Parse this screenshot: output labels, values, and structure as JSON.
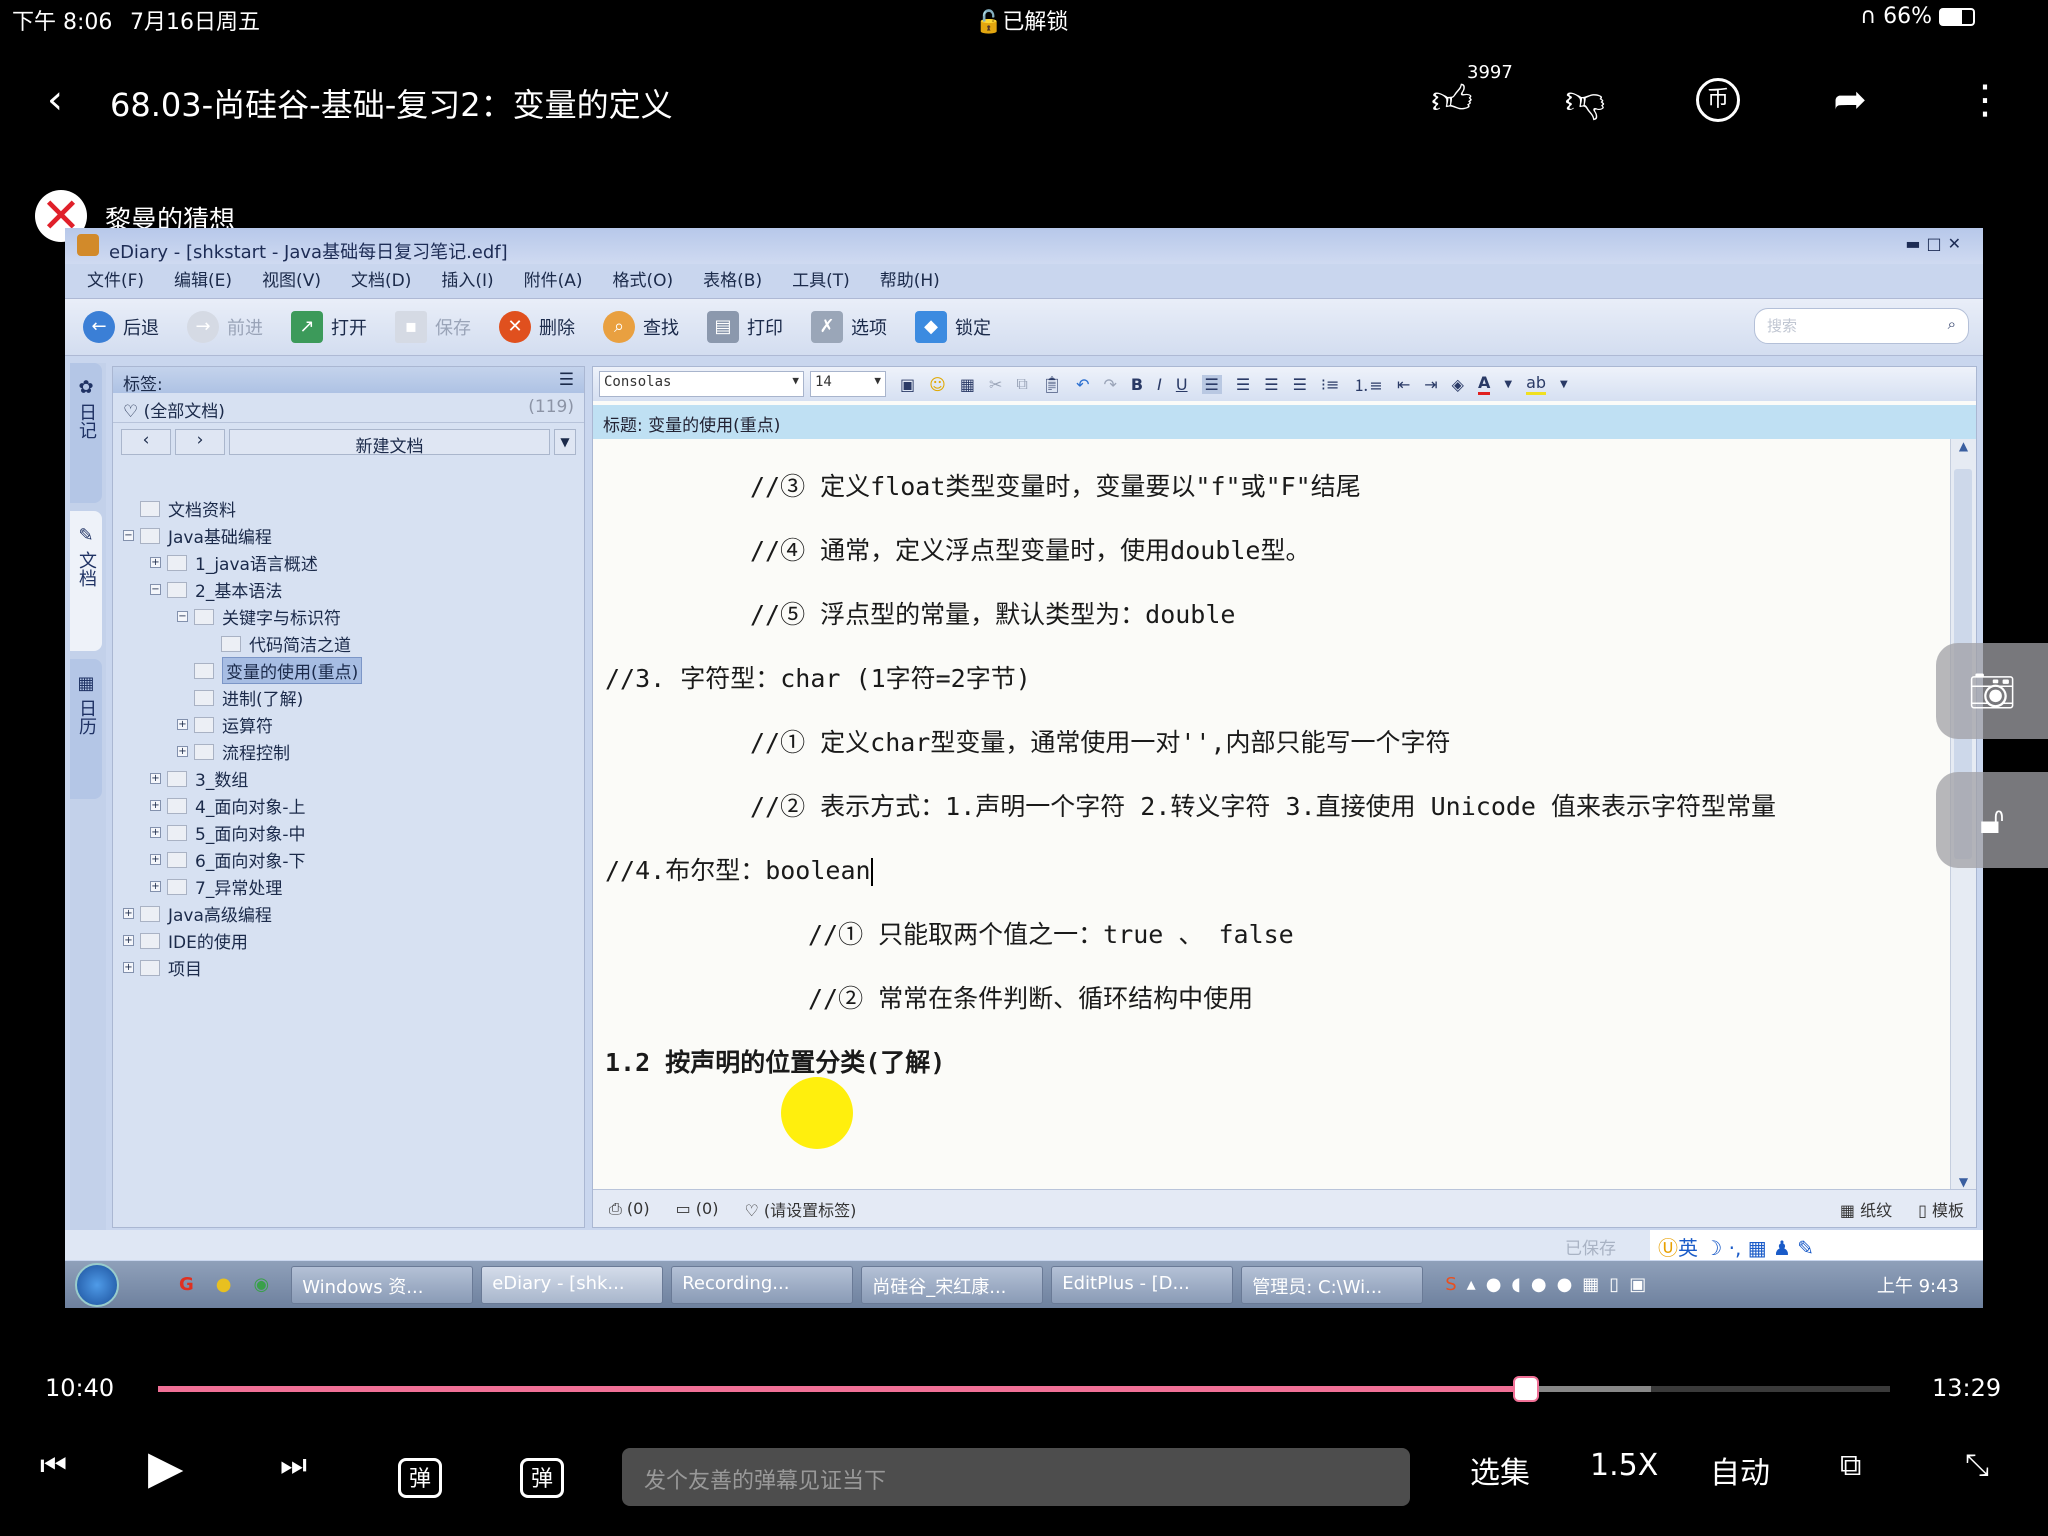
{
  "status_bar": {
    "time": "下午 8:06",
    "date": "7月16日周五",
    "lock": "已解锁",
    "battery": "66%"
  },
  "header": {
    "title": "68.03-尚硅谷-基础-复习2：变量的定义",
    "likes": "3997"
  },
  "uploader": {
    "name": "黎曼的猜想"
  },
  "app": {
    "window_title": "eDiary - [shkstart - Java基础每日复习笔记.edf]",
    "menu": [
      "文件(F)",
      "编辑(E)",
      "视图(V)",
      "文档(D)",
      "插入(I)",
      "附件(A)",
      "格式(O)",
      "表格(B)",
      "工具(T)",
      "帮助(H)"
    ],
    "toolbar": {
      "back": "后退",
      "forward": "前进",
      "open": "打开",
      "save": "保存",
      "delete": "删除",
      "find": "查找",
      "print": "打印",
      "options": "选项",
      "lock": "锁定"
    },
    "search_placeholder": "搜索",
    "side_tabs": [
      "日记",
      "文档",
      "日历"
    ],
    "tags": {
      "header": "标签:",
      "all": "(全部文档)",
      "count": "(119)",
      "new_doc": "新建文档"
    },
    "tree": [
      {
        "label": "文档资料",
        "level": 0,
        "toggle": ""
      },
      {
        "label": "Java基础编程",
        "level": 0,
        "toggle": "−"
      },
      {
        "label": "1_java语言概述",
        "level": 1,
        "toggle": "+"
      },
      {
        "label": "2_基本语法",
        "level": 1,
        "toggle": "−"
      },
      {
        "label": "关键字与标识符",
        "level": 2,
        "toggle": "−"
      },
      {
        "label": "代码简洁之道",
        "level": 3,
        "toggle": ""
      },
      {
        "label": "变量的使用(重点)",
        "level": 2,
        "toggle": "",
        "selected": true
      },
      {
        "label": "进制(了解)",
        "level": 2,
        "toggle": ""
      },
      {
        "label": "运算符",
        "level": 2,
        "toggle": "+"
      },
      {
        "label": "流程控制",
        "level": 2,
        "toggle": "+"
      },
      {
        "label": "3_数组",
        "level": 1,
        "toggle": "+"
      },
      {
        "label": "4_面向对象-上",
        "level": 1,
        "toggle": "+"
      },
      {
        "label": "5_面向对象-中",
        "level": 1,
        "toggle": "+"
      },
      {
        "label": "6_面向对象-下",
        "level": 1,
        "toggle": "+"
      },
      {
        "label": "7_异常处理",
        "level": 1,
        "toggle": "+"
      },
      {
        "label": "Java高级编程",
        "level": 0,
        "toggle": "+"
      },
      {
        "label": "IDE的使用",
        "level": 0,
        "toggle": "+"
      },
      {
        "label": "项目",
        "level": 0,
        "toggle": "+"
      }
    ],
    "format": {
      "font": "Consolas",
      "size": "14",
      "bold": "B",
      "italic": "I",
      "underline": "U"
    },
    "doc_title": "标题: 变量的使用(重点)",
    "lines": [
      {
        "text": "//③ 定义float类型变量时，变量要以\"f\"或\"F\"结尾",
        "indent": 2
      },
      {
        "text": "//④ 通常，定义浮点型变量时，使用double型。",
        "indent": 2
      },
      {
        "text": "//⑤ 浮点型的常量，默认类型为：double",
        "indent": 2
      },
      {
        "text": "//3. 字符型：char (1字符=2字节)",
        "indent": 0
      },
      {
        "text": "//① 定义char型变量，通常使用一对'',内部只能写一个字符",
        "indent": 2
      },
      {
        "text": "//② 表示方式：1.声明一个字符 2.转义字符 3.直接使用 Unicode 值来表示字符型常量",
        "indent": 2
      },
      {
        "text": "//4.布尔型：boolean",
        "indent": 0
      },
      {
        "text": "//① 只能取两个值之一：true 、 false",
        "indent": 3
      },
      {
        "text": "//② 常常在条件判断、循环结构中使用",
        "indent": 3
      },
      {
        "text": "1.2 按声明的位置分类(了解)",
        "indent": 0
      }
    ],
    "editor_status": {
      "attachments": "(0)",
      "comments": "(0)",
      "tag": "(请设置标签)",
      "paper": "纸纹",
      "template": "模板"
    },
    "saved": "已保存",
    "ime": "英",
    "taskbar": [
      "Windows 资...",
      "eDiary - [shk...",
      "Recording...",
      "尚硅谷_宋红康...",
      "EditPlus - [D...",
      "管理员: C:\\Wi..."
    ],
    "clock": "上午 9:43"
  },
  "player": {
    "current": "10:40",
    "total": "13:29",
    "progress": 0.79,
    "buffered": 0.862,
    "danmaku_placeholder": "发个友善的弹幕见证当下",
    "episodes": "选集",
    "speed": "1.5X",
    "quality": "自动"
  },
  "colors": {
    "progress": "#f07096",
    "highlight_cursor": "#ffee00"
  }
}
